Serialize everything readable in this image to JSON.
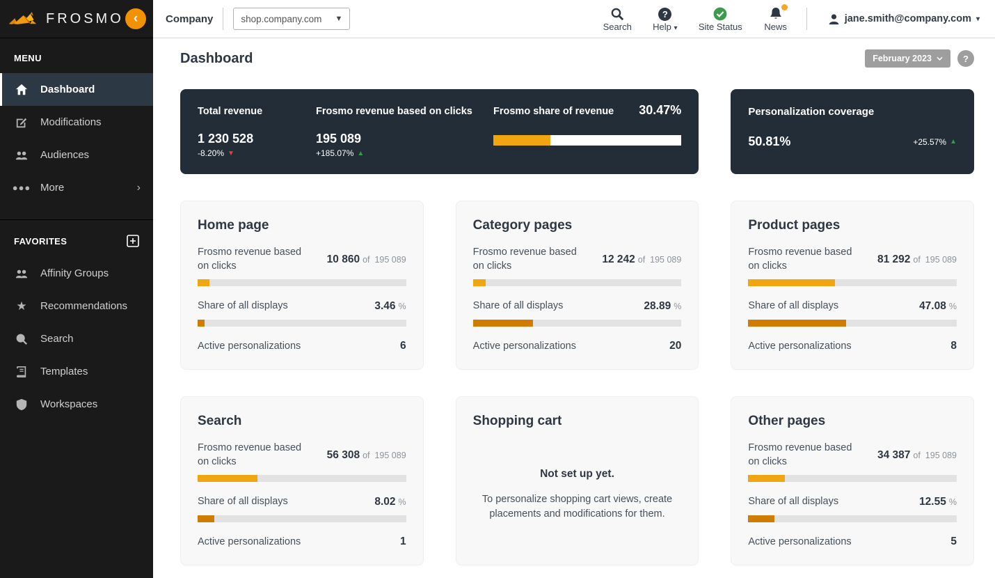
{
  "sidebar": {
    "logo_text": "FROSMO",
    "collapse_glyph": "‹",
    "menu_label": "MENU",
    "menu_items": [
      {
        "label": "Dashboard"
      },
      {
        "label": "Modifications"
      },
      {
        "label": "Audiences"
      },
      {
        "label": "More"
      }
    ],
    "more_chevron": "›",
    "favorites_label": "FAVORITES",
    "favorites_items": [
      {
        "label": "Affinity Groups"
      },
      {
        "label": "Recommendations"
      },
      {
        "label": "Search"
      },
      {
        "label": "Templates"
      },
      {
        "label": "Workspaces"
      }
    ]
  },
  "topbar": {
    "company_label": "Company",
    "site_selected": "shop.company.com",
    "search_label": "Search",
    "help_label": "Help",
    "site_status_label": "Site Status",
    "news_label": "News",
    "user_email": "jane.smith@company.com"
  },
  "header": {
    "title": "Dashboard",
    "period": "February 2023",
    "help_glyph": "?"
  },
  "labels": {
    "revenue_label": "Frosmo revenue based on clicks",
    "share_label": "Share of all displays",
    "active_label": "Active personalizations",
    "of_label": "of",
    "percent_suffix": "%"
  },
  "colors": {
    "accent_orange": "#f29104",
    "bar_light_orange": "#f0a511",
    "bar_dark_orange": "#d07c00",
    "dark_card_bg": "#232d38",
    "trend_up_green": "#2f9e48",
    "trend_down_red": "#e04438"
  },
  "summary": {
    "total_revenue": {
      "label": "Total revenue",
      "value": "1 230 528",
      "change": "-8.20%",
      "trend": "down"
    },
    "frosmo_revenue": {
      "label": "Frosmo revenue based on clicks",
      "value": "195 089",
      "change": "+185.07%",
      "trend": "up"
    },
    "share_of_revenue": {
      "label": "Frosmo share of revenue",
      "value": "30.47%",
      "pct": 30.47
    },
    "coverage": {
      "label": "Personalization coverage",
      "value": "50.81%",
      "change": "+25.57%",
      "trend": "up"
    }
  },
  "page_cards": [
    {
      "title": "Home page",
      "revenue_value": "10 860",
      "revenue_total": "195 089",
      "revenue_pct": 5.57,
      "share_value": "3.46",
      "share_pct": 3.46,
      "active_count": "6"
    },
    {
      "title": "Category pages",
      "revenue_value": "12 242",
      "revenue_total": "195 089",
      "revenue_pct": 6.27,
      "share_value": "28.89",
      "share_pct": 28.89,
      "active_count": "20"
    },
    {
      "title": "Product pages",
      "revenue_value": "81 292",
      "revenue_total": "195 089",
      "revenue_pct": 41.67,
      "share_value": "47.08",
      "share_pct": 47.08,
      "active_count": "8"
    },
    {
      "title": "Search",
      "revenue_value": "56 308",
      "revenue_total": "195 089",
      "revenue_pct": 28.86,
      "share_value": "8.02",
      "share_pct": 8.02,
      "active_count": "1"
    },
    {
      "title": "Shopping cart",
      "empty_title": "Not set up yet.",
      "empty_text": "To personalize shopping cart views, create placements and modifications for them."
    },
    {
      "title": "Other pages",
      "revenue_value": "34 387",
      "revenue_total": "195 089",
      "revenue_pct": 17.63,
      "share_value": "12.55",
      "share_pct": 12.55,
      "active_count": "5"
    }
  ]
}
